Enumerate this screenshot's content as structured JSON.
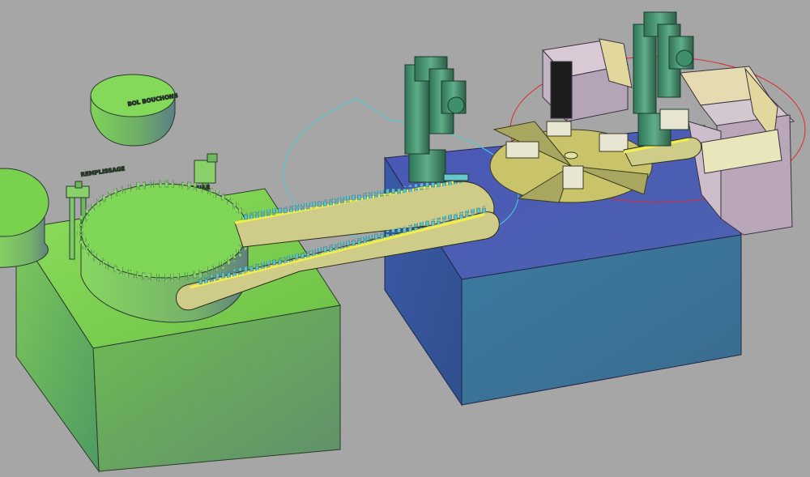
{
  "labels": {
    "bowl": "BOL BOUCHONS",
    "filling": "REMPLISSAGE",
    "capping": "FERMETURE"
  },
  "colors": {
    "background": "#a6a6a6",
    "green_block": "#7dce4e",
    "blue_block": "#4d5fb4",
    "conveyor": "#cfcc8a",
    "conveyor_edge": "#f2ee4a",
    "robot": "#3f8f6a",
    "box": "#c8b8c4",
    "turntable": "#c9c46a",
    "reach_cyan": "#48d0d8",
    "reach_red": "#e02828"
  }
}
